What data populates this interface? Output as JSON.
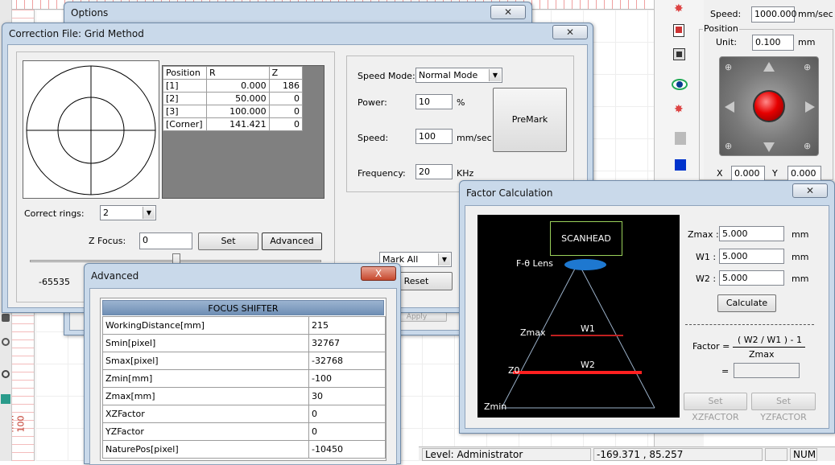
{
  "background": {
    "ruler_label": "mm  100"
  },
  "options": {
    "title": "Options",
    "bottom_btn": "Apply"
  },
  "grid_method": {
    "title": "Correction File: Grid Method",
    "table": {
      "headers": [
        "Position",
        "R",
        "Z"
      ],
      "rows": [
        [
          "[1]",
          "0.000",
          "186"
        ],
        [
          "[2]",
          "50.000",
          "0"
        ],
        [
          "[3]",
          "100.000",
          "0"
        ],
        [
          "[Corner]",
          "141.421",
          "0"
        ]
      ]
    },
    "correct_rings_label": "Correct rings:",
    "correct_rings_value": "2",
    "z_focus_label": "Z Focus:",
    "z_focus_value": "0",
    "set_btn": "Set",
    "advanced_btn": "Advanced",
    "slider_min": "-65535",
    "speed_mode_label": "Speed Mode:",
    "speed_mode_value": "Normal Mode",
    "power_label": "Power:",
    "power_value": "10",
    "power_unit": "%",
    "speed_label": "Speed:",
    "speed_value": "100",
    "speed_unit": "mm/sec",
    "frequency_label": "Frequency:",
    "frequency_value": "20",
    "frequency_unit": "KHz",
    "premark_btn": "PreMark",
    "mark_all_value": "Mark All",
    "reset_btn": "Reset"
  },
  "advanced": {
    "title": "Advanced",
    "close": "X",
    "header": "FOCUS SHIFTER",
    "rows": [
      [
        "WorkingDistance[mm]",
        "215"
      ],
      [
        "Smin[pixel]",
        "32767"
      ],
      [
        "Smax[pixel]",
        "-32768"
      ],
      [
        "Zmin[mm]",
        "-100"
      ],
      [
        "Zmax[mm]",
        "30"
      ],
      [
        "XZFactor",
        "0"
      ],
      [
        "YZFactor",
        "0"
      ],
      [
        "NaturePos[pixel]",
        "-10450"
      ]
    ]
  },
  "factor": {
    "title": "Factor Calculation",
    "diagram": {
      "scanhead": "SCANHEAD",
      "lens": "F-θ Lens",
      "zmax": "Zmax",
      "w1": "W1",
      "z0": "Z0",
      "w2": "W2",
      "zmin": "Zmin"
    },
    "zmax_label": "Zmax :",
    "zmax_value": "5.000",
    "w1_label": "W1 :",
    "w1_value": "5.000",
    "w2_label": "W2 :",
    "w2_value": "5.000",
    "unit": "mm",
    "calculate_btn": "Calculate",
    "factor_label": "Factor =",
    "formula_num": "( W2 / W1 ) - 1",
    "formula_den": "Zmax",
    "equals": "=",
    "set_xz_btn": "Set XZFACTOR",
    "set_yz_btn": "Set YZFACTOR"
  },
  "right_panel": {
    "speed_label": "Speed:",
    "speed_value": "1000.000",
    "speed_unit": "mm/sec",
    "position_label": "Position",
    "unit_label": "Unit:",
    "unit_value": "0.100",
    "unit_unit": "mm",
    "x_label": "X",
    "x_value": "0.000",
    "y_label": "Y",
    "y_value": "0.000"
  },
  "status": {
    "level": "Level: Administrator",
    "coords": "-169.371 , 85.257",
    "num": "NUM"
  },
  "colors": {
    "diagram_bg": "#000000",
    "w2_line": "#ff2020",
    "w1_line": "#c02020",
    "lens": "#1e78d0",
    "scanhead_border": "#9ad05a",
    "table_header": "#6f8fb5"
  }
}
